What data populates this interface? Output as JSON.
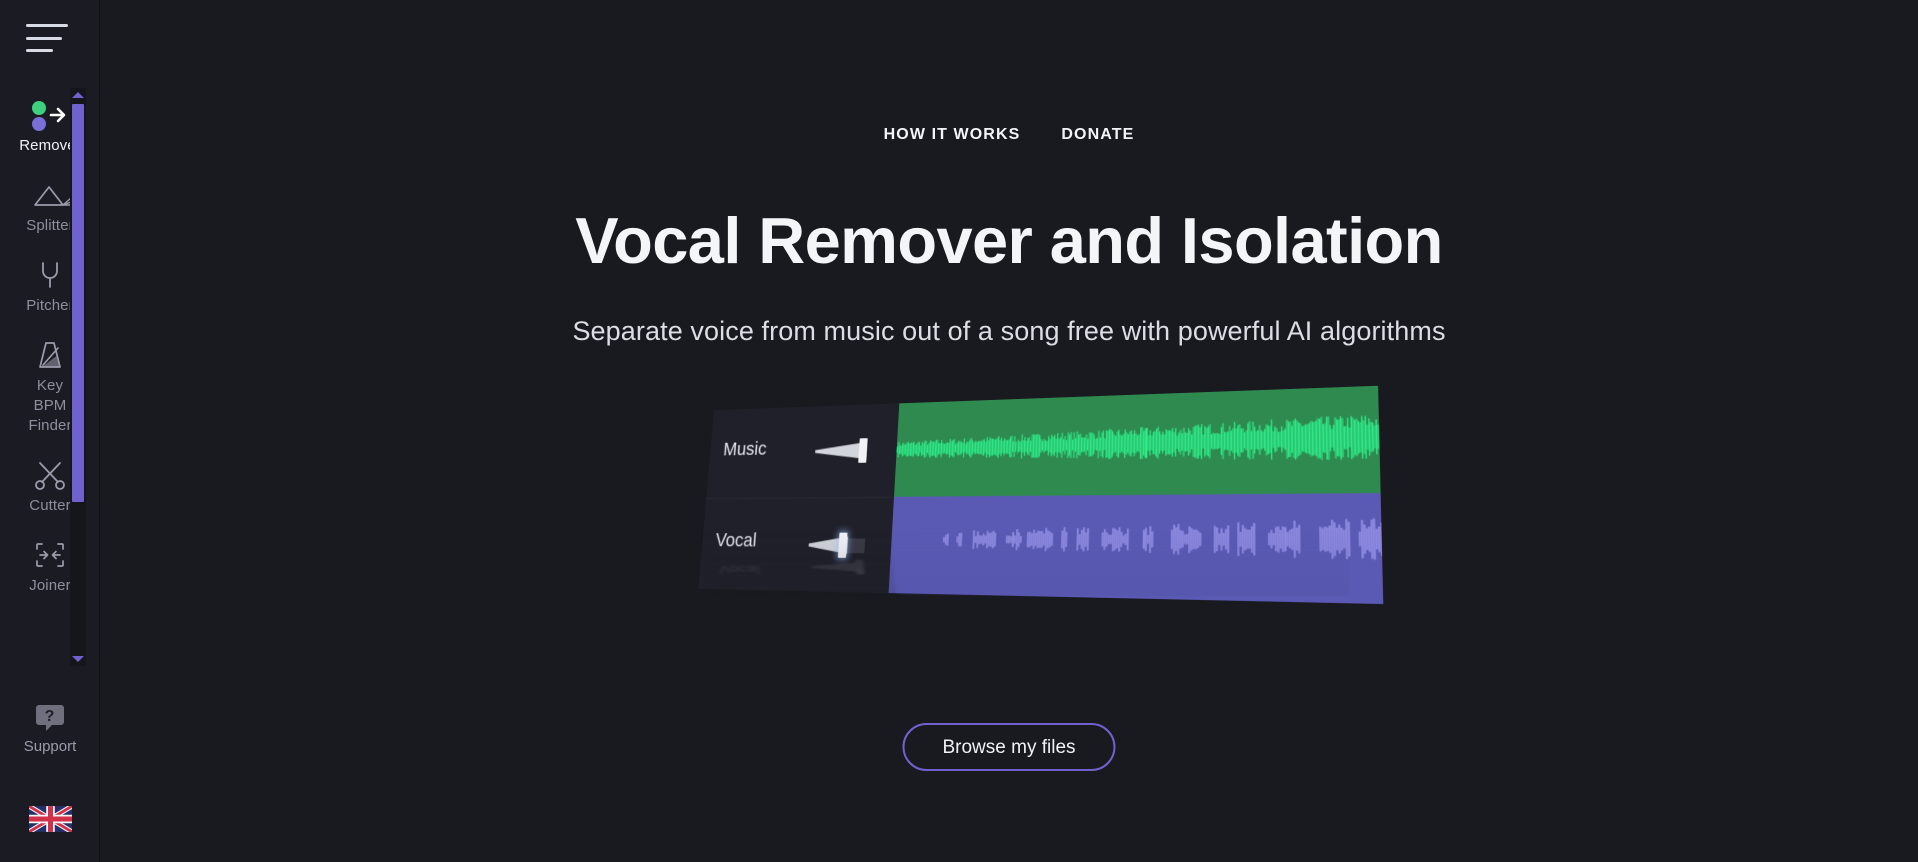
{
  "window": {
    "background_color": "#191920",
    "sidebar_color": "#1b1b23",
    "accent_color": "#6f62cf"
  },
  "sidebar": {
    "menu_button": {
      "icon": "hamburger-menu-icon"
    },
    "items": [
      {
        "id": "remover",
        "label": "Remover",
        "icon": "remover-dots-arrow-icon",
        "active": true
      },
      {
        "id": "splitter",
        "label": "Splitter",
        "icon": "splitter-prism-icon",
        "active": false
      },
      {
        "id": "pitcher",
        "label": "Pitcher",
        "icon": "tuning-fork-icon",
        "active": false
      },
      {
        "id": "keybpm",
        "label": "Key\nBPM\nFinder",
        "icon": "metronome-icon",
        "active": false
      },
      {
        "id": "cutter",
        "label": "Cutter",
        "icon": "scissors-icon",
        "active": false
      },
      {
        "id": "joiner",
        "label": "Joiner",
        "icon": "joiner-merge-icon",
        "active": false
      }
    ],
    "scrollbar": {
      "up_arrow_icon": "chevron-up-icon",
      "down_arrow_icon": "chevron-down-icon",
      "thumb_color": "#6f62cf"
    },
    "support": {
      "label": "Support",
      "icon": "question-bubble-icon"
    },
    "language": {
      "icon": "uk-flag-icon",
      "value": "English"
    }
  },
  "topnav": {
    "links": [
      {
        "id": "how-it-works",
        "label": "HOW IT WORKS"
      },
      {
        "id": "donate",
        "label": "DONATE"
      }
    ]
  },
  "hero": {
    "title": "Vocal Remover and Isolation",
    "subtitle": "Separate voice from music out of a song free with powerful AI algorithms",
    "cta_label": "Browse my files"
  },
  "illustration": {
    "alt": "audio-track-editor-preview",
    "tracks": [
      {
        "id": "music",
        "label": "Music",
        "color": "#2e8a4f",
        "wave_color": "#2df08a",
        "slider_value": 78,
        "slider_active": false
      },
      {
        "id": "vocal",
        "label": "Vocal",
        "color": "#5a5ab4",
        "wave_color": "#8d8ae0",
        "slider_value": 52,
        "slider_active": true
      }
    ],
    "reflection_label": "Vocal"
  }
}
